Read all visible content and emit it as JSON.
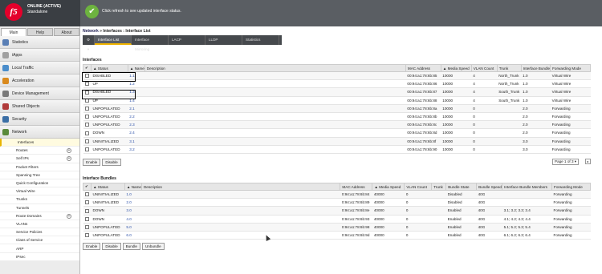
{
  "header": {
    "logo": "f5",
    "status": "ONLINE (ACTIVE)",
    "mode": "Standalone",
    "message": "Click refresh to see updated interface status.",
    "check": "✔"
  },
  "side": {
    "tabs": [
      "Main",
      "Help",
      "About"
    ],
    "nav": [
      {
        "label": "Statistics",
        "color": "#5a7fb5"
      },
      {
        "label": "iApps",
        "color": "#a0a0a0"
      },
      {
        "label": "Local Traffic",
        "color": "#4a8dcb"
      },
      {
        "label": "Acceleration",
        "color": "#d98a1e"
      },
      {
        "label": "Device Management",
        "color": "#7a7a7a"
      },
      {
        "label": "Shared Objects",
        "color": "#b03a3a"
      },
      {
        "label": "Security",
        "color": "#3b6fa6"
      },
      {
        "label": "Network",
        "color": "#5a8a3b"
      }
    ],
    "sub": [
      "Interfaces",
      "Routes",
      "Self IPs",
      "Packet Filters",
      "Spanning Tree",
      "Quick Configuration",
      "Virtual Wire",
      "Trunks",
      "Tunnels",
      "Route Domains",
      "VLANs",
      "Service Policies",
      "Class of Service",
      "ARP",
      "IPsec"
    ]
  },
  "crumbs": {
    "a": "Network",
    "sep": "»",
    "b": "Interfaces : Interface List"
  },
  "menu": {
    "gear": "⚙ ▾",
    "items": [
      "Interface List",
      "Interface Mirroring",
      "LACP",
      "LLDP",
      "Statistics"
    ]
  },
  "interfaces": {
    "title": "Interfaces",
    "headers": [
      "✔",
      "▲ Status",
      "▲ Name",
      "Description",
      "MAC Address",
      "▲ Media Speed",
      "VLAN Count",
      "Trunk",
      "Interface Bundle",
      "Forwarding Mode"
    ],
    "rows": [
      [
        "DISABLED",
        "1.1",
        "",
        "00:94:a1:78:6b:85",
        "10000",
        "4",
        "North_Trunk",
        "1.0",
        "Virtual Wire"
      ],
      [
        "UP",
        "1.2",
        "",
        "00:94:a1:78:6b:86",
        "10000",
        "4",
        "North_Trunk",
        "1.0",
        "Virtual Wire"
      ],
      [
        "DISABLED",
        "1.3",
        "",
        "00:94:a1:78:6b:87",
        "10000",
        "4",
        "South_Trunk",
        "1.0",
        "Virtual Wire"
      ],
      [
        "UP",
        "1.4",
        "",
        "00:94:a1:78:6b:88",
        "10000",
        "4",
        "South_Trunk",
        "1.0",
        "Virtual Wire"
      ],
      [
        "UNPOPULATED",
        "2.1",
        "",
        "00:94:a1:78:6b:8a",
        "10000",
        "0",
        "",
        "2.0",
        "Forwarding"
      ],
      [
        "UNPOPULATED",
        "2.2",
        "",
        "00:94:a1:78:6b:8b",
        "10000",
        "0",
        "",
        "2.0",
        "Forwarding"
      ],
      [
        "UNPOPULATED",
        "2.3",
        "",
        "00:94:a1:78:6b:8c",
        "10000",
        "0",
        "",
        "2.0",
        "Forwarding"
      ],
      [
        "DOWN",
        "2.4",
        "",
        "00:94:a1:78:6b:8d",
        "10000",
        "0",
        "",
        "2.0",
        "Forwarding"
      ],
      [
        "UNINITIALIZED",
        "3.1",
        "",
        "00:94:a1:78:6b:8f",
        "10000",
        "0",
        "",
        "3.0",
        "Forwarding"
      ],
      [
        "UNPOPULATED",
        "3.2",
        "",
        "00:94:a1:78:6b:90",
        "10000",
        "0",
        "",
        "3.0",
        "Forwarding"
      ]
    ],
    "buttons": [
      "Enable",
      "Disable"
    ],
    "pager": "Page 1 of 3 ▾",
    "pager_arrow": "▸"
  },
  "bundles": {
    "title": "Interface Bundles",
    "headers": [
      "✔",
      "▲ Status",
      "▲ Name",
      "Description",
      "MAC Address",
      "▲ Media Speed",
      "VLAN Count",
      "Trunk",
      "Bundle State",
      "Bundle Speed",
      "Interface Bundle Members",
      "Forwarding Mode"
    ],
    "rows": [
      [
        "UNINITIALIZED",
        "1.0",
        "",
        "0:94:a1:78:6b:84",
        "40000",
        "0",
        "",
        "Disabled",
        "40G",
        "",
        "Forwarding"
      ],
      [
        "UNINITIALIZED",
        "2.0",
        "",
        "0:94:a1:78:6b:89",
        "40000",
        "0",
        "",
        "Disabled",
        "40G",
        "",
        "Forwarding"
      ],
      [
        "DOWN",
        "3.0",
        "",
        "0:94:a1:78:6b:8e",
        "40000",
        "0",
        "",
        "Enabled",
        "40G",
        "3.1; 3.2; 3.3; 3.4",
        "Forwarding"
      ],
      [
        "DOWN",
        "4.0",
        "",
        "0:94:a1:78:6b:93",
        "40000",
        "0",
        "",
        "Enabled",
        "40G",
        "4.1; 4.2; 4.3; 4.4",
        "Forwarding"
      ],
      [
        "UNPOPULATED",
        "5.0",
        "",
        "0:94:a1:78:6b:98",
        "40000",
        "0",
        "",
        "Enabled",
        "40G",
        "5.1; 5.2; 5.3; 5.4",
        "Forwarding"
      ],
      [
        "UNPOPULATED",
        "6.0",
        "",
        "0:94:a1:78:6b:9d",
        "40000",
        "0",
        "",
        "Enabled",
        "40G",
        "6.1; 6.2; 6.3; 6.4",
        "Forwarding"
      ]
    ],
    "buttons": [
      "Enable",
      "Disable",
      "Bundle",
      "Unbundle"
    ]
  }
}
